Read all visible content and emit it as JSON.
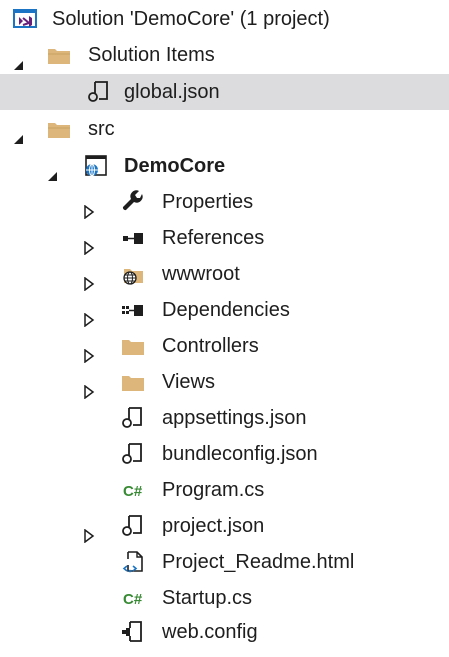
{
  "tree": {
    "solution": {
      "label": "Solution 'DemoCore' (1 project)",
      "icon": "visual-studio-solution-icon"
    },
    "solution_items": {
      "label": "Solution Items",
      "icon": "folder-icon",
      "expanded": true
    },
    "global_json": {
      "label": "global.json",
      "icon": "json-file-icon",
      "selected": true
    },
    "src": {
      "label": "src",
      "icon": "folder-icon",
      "expanded": true
    },
    "project": {
      "label": "DemoCore",
      "icon": "web-project-icon",
      "expanded": true
    },
    "items": [
      {
        "label": "Properties",
        "icon": "wrench-icon",
        "expandable": true
      },
      {
        "label": "References",
        "icon": "references-icon",
        "expandable": true
      },
      {
        "label": "wwwroot",
        "icon": "globe-folder-icon",
        "expandable": true
      },
      {
        "label": "Dependencies",
        "icon": "dependencies-icon",
        "expandable": true
      },
      {
        "label": "Controllers",
        "icon": "folder-icon",
        "expandable": true
      },
      {
        "label": "Views",
        "icon": "folder-icon",
        "expandable": true
      },
      {
        "label": "appsettings.json",
        "icon": "json-file-icon",
        "expandable": false
      },
      {
        "label": "bundleconfig.json",
        "icon": "json-file-icon",
        "expandable": false
      },
      {
        "label": "Program.cs",
        "icon": "csharp-file-icon",
        "expandable": false
      },
      {
        "label": "project.json",
        "icon": "json-file-icon",
        "expandable": true
      },
      {
        "label": "Project_Readme.html",
        "icon": "html-file-icon",
        "expandable": false
      },
      {
        "label": "Startup.cs",
        "icon": "csharp-file-icon",
        "expandable": false
      },
      {
        "label": "web.config",
        "icon": "config-file-icon",
        "expandable": false
      }
    ]
  },
  "colors": {
    "selection": "#dcdcde",
    "folder": "#dcb67a",
    "csharp": "#388a34",
    "globe_blue": "#1b74c4",
    "arrow": "#1e1e1e"
  }
}
